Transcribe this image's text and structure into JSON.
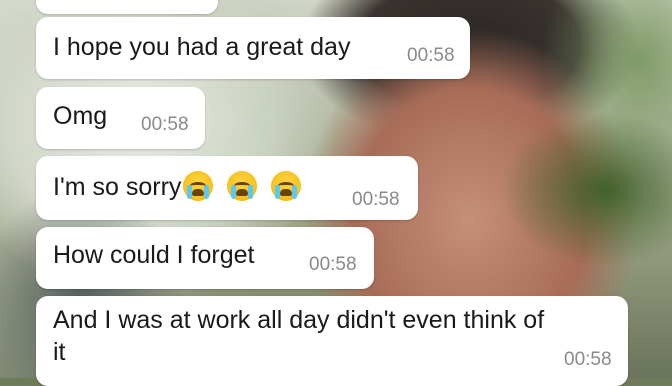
{
  "chat": {
    "messages": [
      {
        "text": "",
        "time": ""
      },
      {
        "text": "I hope you had a great day",
        "time": "00:58"
      },
      {
        "text": "Omg",
        "time": "00:58"
      },
      {
        "text": "I'm so sorry",
        "emojis": [
          "loudly-crying-face-icon",
          "loudly-crying-face-icon",
          "loudly-crying-face-icon"
        ],
        "time": "00:58"
      },
      {
        "text": "How could I forget",
        "time": "00:58"
      },
      {
        "text_line1": "And I was at work all day didn't even think of",
        "text_line2": "it",
        "time": "00:58"
      }
    ]
  },
  "colors": {
    "bubble": "#ffffff",
    "text": "#1a1a1a",
    "timestamp": "#8a8a8a"
  }
}
